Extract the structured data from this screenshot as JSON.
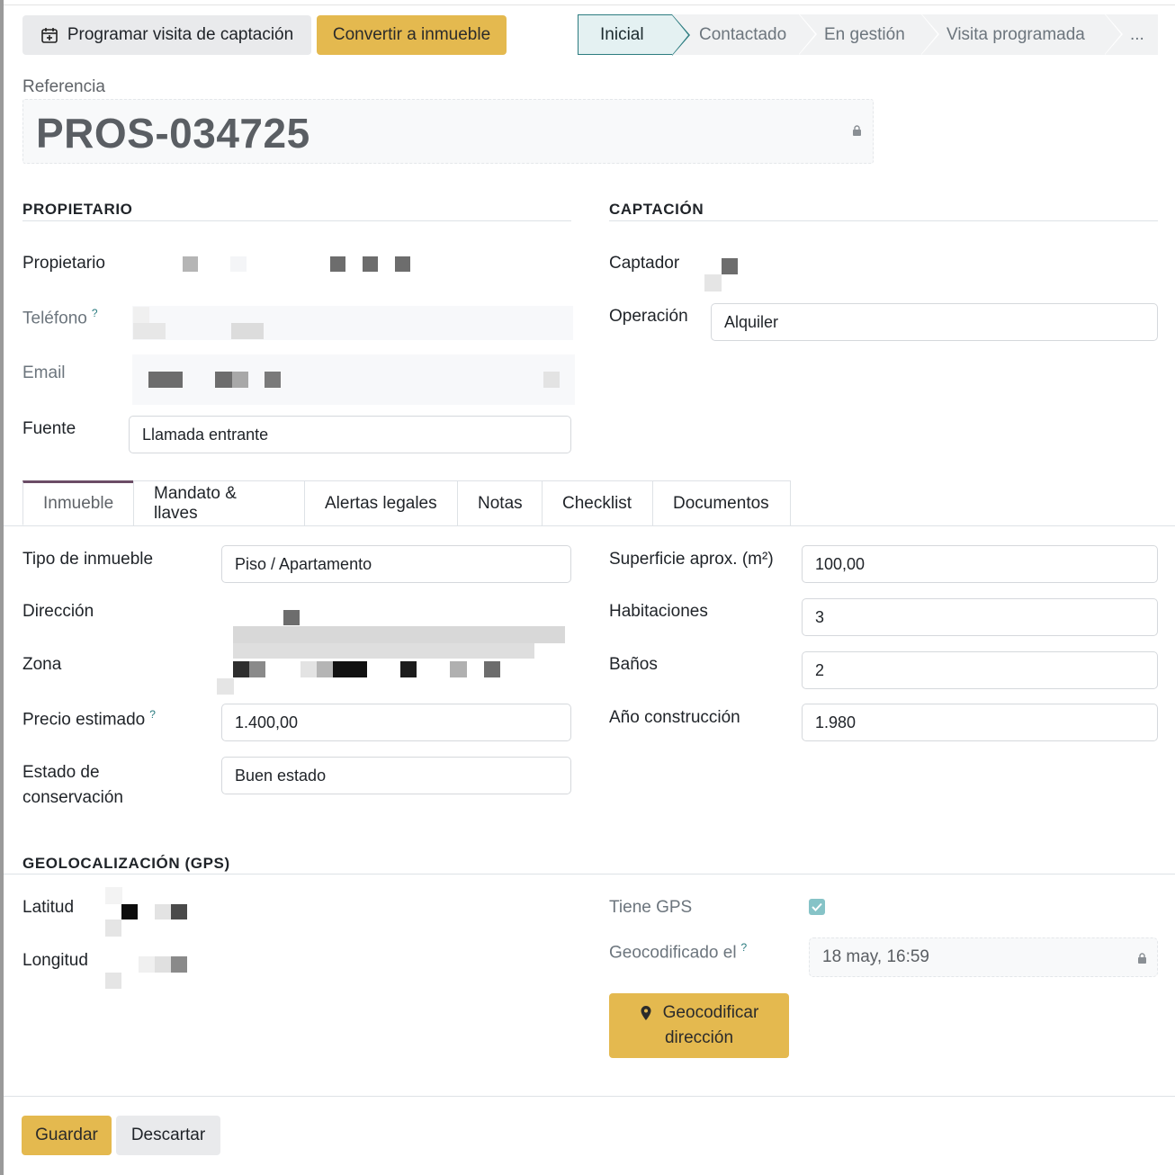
{
  "toolbar": {
    "schedule_label": "Programar visita de captación",
    "schedule_icon": "calendar-plus-icon",
    "convert_label": "Convertir a inmueble"
  },
  "statusbar": {
    "stages": [
      "Inicial",
      "Contactado",
      "En gestión",
      "Visita programada"
    ],
    "active": "Inicial",
    "more": "..."
  },
  "reference": {
    "label": "Referencia",
    "value": "PROS-034725"
  },
  "owner": {
    "section_title": "PROPIETARIO",
    "owner_label": "Propietario",
    "phone_label": "Teléfono",
    "email_label": "Email",
    "source_label": "Fuente",
    "source_value": "Llamada entrante",
    "help_mark": "?"
  },
  "capture": {
    "section_title": "CAPTACIÓN",
    "captor_label": "Captador",
    "operation_label": "Operación",
    "operation_value": "Alquiler"
  },
  "tabs": [
    "Inmueble",
    "Mandato & llaves",
    "Alertas legales",
    "Notas",
    "Checklist",
    "Documentos"
  ],
  "property": {
    "type_label": "Tipo de inmueble",
    "type_value": "Piso / Apartamento",
    "address_label": "Dirección",
    "zone_label": "Zona",
    "price_label": "Precio estimado",
    "price_value": "1.400,00",
    "condition_label_1": "Estado de",
    "condition_label_2": "conservación",
    "condition_value": "Buen estado",
    "surface_label": "Superficie aprox. (m²)",
    "surface_value": "100,00",
    "rooms_label": "Habitaciones",
    "rooms_value": "3",
    "baths_label": "Baños",
    "baths_value": "2",
    "year_label": "Año construcción",
    "year_value": "1.980"
  },
  "geo": {
    "section_title": "GEOLOCALIZACIÓN (GPS)",
    "lat_label": "Latitud",
    "lon_label": "Longitud",
    "has_gps_label": "Tiene GPS",
    "has_gps": true,
    "geocoded_label": "Geocodificado el",
    "geocoded_value": "18 may, 16:59",
    "button_line1": "Geocodificar",
    "button_line2": "dirección"
  },
  "footer": {
    "save_label": "Guardar",
    "discard_label": "Descartar"
  }
}
